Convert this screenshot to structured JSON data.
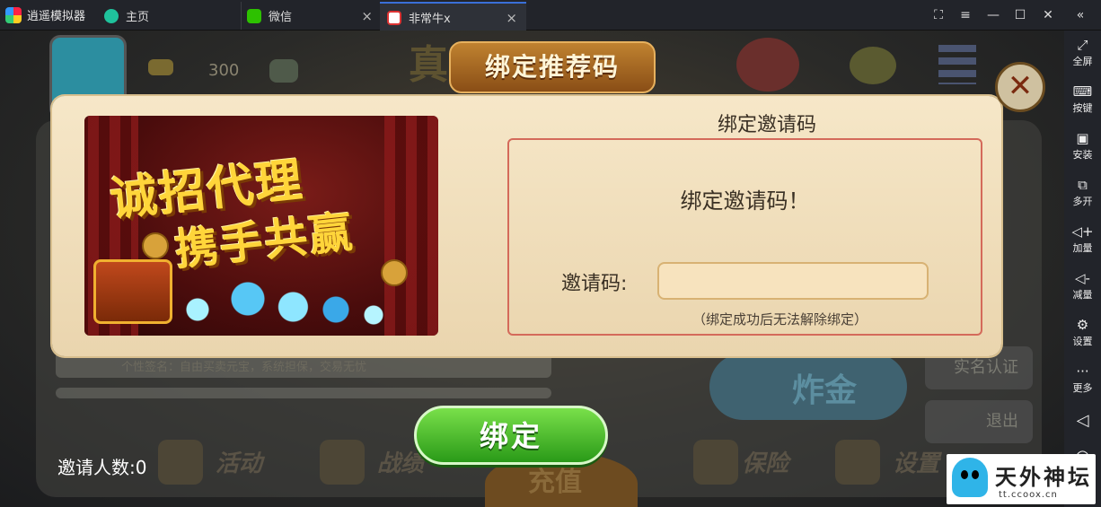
{
  "emulator": {
    "app_title": "逍遥模拟器",
    "tabs": [
      {
        "label": "主页"
      },
      {
        "label": "微信"
      },
      {
        "label": "非常牛x"
      }
    ],
    "tab_close_glyph": "×",
    "sidebar": [
      {
        "label": "全屏",
        "icon": "fullscreen-icon"
      },
      {
        "label": "按键",
        "icon": "keyboard-icon"
      },
      {
        "label": "安装",
        "icon": "apk-icon"
      },
      {
        "label": "多开",
        "icon": "multi-instance-icon"
      },
      {
        "label": "加量",
        "icon": "volume-up-icon"
      },
      {
        "label": "减量",
        "icon": "volume-down-icon"
      },
      {
        "label": "设置",
        "icon": "gear-icon"
      },
      {
        "label": "更多",
        "icon": "more-icon"
      }
    ]
  },
  "background": {
    "coins": "300",
    "signature": "个性签名：自由买卖元宝，系统担保，交易无忧",
    "zhajin": "炸金",
    "side_buttons": [
      "实名认证",
      "退出"
    ],
    "nav": [
      "活动",
      "战绩",
      "充值",
      "保险",
      "设置"
    ]
  },
  "modal": {
    "title": "绑定推荐码",
    "banner_line1": "诚招代理",
    "banner_line2": "携手共赢",
    "heading": "绑定邀请码",
    "message": "绑定邀请码！",
    "input_label": "邀请码:",
    "input_value": "",
    "note": "（绑定成功后无法解除绑定）",
    "bind_button": "绑定",
    "close_glyph": "✕",
    "invite_count": "邀请人数:0"
  },
  "watermark": {
    "text": "天外神坛",
    "url": "tt.ccoox.cn"
  }
}
